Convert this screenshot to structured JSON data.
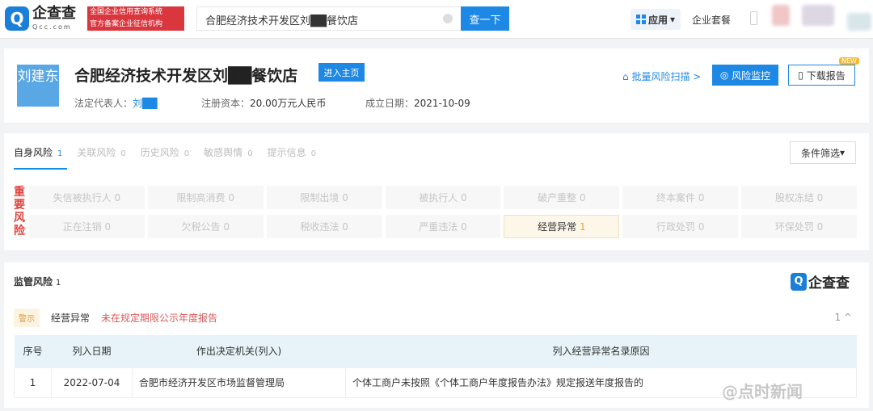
{
  "header": {
    "logo_text": "企查查",
    "logo_sub": "Qcc.com",
    "badge_line1": "全国企业信用查询系统",
    "badge_line2": "官方备案企业征信机构",
    "search_value": "合肥经济技术开发区刘██餐饮店",
    "search_button": "查一下",
    "app_menu": "应用",
    "package": "企业套餐"
  },
  "company": {
    "avatar_text": "刘建东",
    "name": "合肥经济技术开发区刘██餐饮店",
    "enter_button": "进入主页",
    "legal_rep_label": "法定代表人：",
    "legal_rep": "刘██",
    "capital_label": "注册资本：",
    "capital": "20.00万元人民币",
    "founded_label": "成立日期：",
    "founded": "2021-10-09",
    "batch_scan": "批量风险扫描 >",
    "monitor_button": "风险监控",
    "download_button": "下载报告",
    "new_badge": "NEW"
  },
  "tabs": [
    {
      "label": "自身风险",
      "count": "1"
    },
    {
      "label": "关联风险",
      "count": "0"
    },
    {
      "label": "历史风险",
      "count": "0"
    },
    {
      "label": "敏感舆情",
      "count": "0"
    },
    {
      "label": "提示信息",
      "count": "0"
    }
  ],
  "filter": "条件筛选",
  "important_label": "重要风险",
  "risk_items": [
    {
      "label": "失信被执行人",
      "count": "0"
    },
    {
      "label": "限制高消费",
      "count": "0"
    },
    {
      "label": "限制出境",
      "count": "0"
    },
    {
      "label": "被执行人",
      "count": "0"
    },
    {
      "label": "破产重整",
      "count": "0"
    },
    {
      "label": "终本案件",
      "count": "0"
    },
    {
      "label": "股权冻结",
      "count": "0"
    },
    {
      "label": "正在注销",
      "count": "0"
    },
    {
      "label": "欠税公告",
      "count": "0"
    },
    {
      "label": "税收违法",
      "count": "0"
    },
    {
      "label": "严重违法",
      "count": "0"
    },
    {
      "label": "经营异常",
      "count": "1",
      "active": true
    },
    {
      "label": "行政处罚",
      "count": "0"
    },
    {
      "label": "环保处罚",
      "count": "0"
    }
  ],
  "regulatory": {
    "title": "监管风险",
    "count": "1",
    "watermark": "企查查",
    "warning_tag": "警示",
    "type": "经营异常",
    "desc": "未在规定期限公示年度报告",
    "item_count": "1 ^",
    "columns": [
      "序号",
      "列入日期",
      "作出决定机关(列入)",
      "列入经营异常名录原因"
    ],
    "rows": [
      [
        "1",
        "2022-07-04",
        "合肥市经济开发区市场监督管理局",
        "个体工商户未按照《个体工商户年度报告办法》规定报送年度报告的"
      ]
    ]
  },
  "source_watermark": "@点时新闻"
}
